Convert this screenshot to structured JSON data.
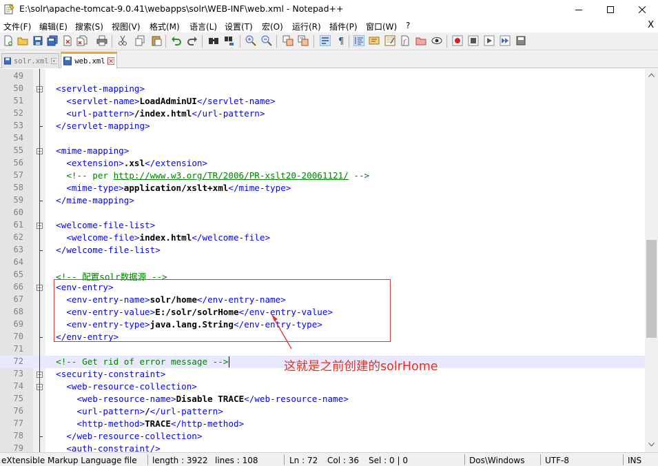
{
  "window": {
    "title": "E:\\solr\\apache-tomcat-9.0.41\\webapps\\solr\\WEB-INF\\web.xml - Notepad++"
  },
  "menu": {
    "items": [
      "文件(F)",
      "编辑(E)",
      "搜索(S)",
      "视图(V)",
      "格式(M)",
      "语言(L)",
      "设置(T)",
      "宏(O)",
      "运行(R)",
      "插件(P)",
      "窗口(W)",
      "?"
    ],
    "close": "X"
  },
  "tabs": [
    {
      "label": "solr.xml",
      "active": false
    },
    {
      "label": "web.xml",
      "active": true
    }
  ],
  "editor": {
    "current_line": 72,
    "lines": [
      {
        "n": "49",
        "segs": []
      },
      {
        "n": "50",
        "segs": [
          [
            "t",
            "  <servlet-mapping>"
          ]
        ]
      },
      {
        "n": "51",
        "segs": [
          [
            "t",
            "    <servlet-name>"
          ],
          [
            "x",
            "LoadAdminUI"
          ],
          [
            "t",
            "</servlet-name>"
          ]
        ]
      },
      {
        "n": "52",
        "segs": [
          [
            "t",
            "    <url-pattern>"
          ],
          [
            "x",
            "/index.html"
          ],
          [
            "t",
            "</url-pattern>"
          ]
        ]
      },
      {
        "n": "53",
        "segs": [
          [
            "t",
            "  </servlet-mapping>"
          ]
        ]
      },
      {
        "n": "54",
        "segs": []
      },
      {
        "n": "55",
        "segs": [
          [
            "t",
            "  <mime-mapping>"
          ]
        ]
      },
      {
        "n": "56",
        "segs": [
          [
            "t",
            "    <extension>"
          ],
          [
            "x",
            ".xsl"
          ],
          [
            "t",
            "</extension>"
          ]
        ]
      },
      {
        "n": "57",
        "segs": [
          [
            "c",
            "    <!-- per "
          ],
          [
            "u",
            "http://www.w3.org/TR/2006/PR-xslt20-20061121/"
          ],
          [
            "c",
            " -->"
          ]
        ]
      },
      {
        "n": "58",
        "segs": [
          [
            "t",
            "    <mime-type>"
          ],
          [
            "x",
            "application/xslt+xml"
          ],
          [
            "t",
            "</mime-type>"
          ]
        ]
      },
      {
        "n": "59",
        "segs": [
          [
            "t",
            "  </mime-mapping>"
          ]
        ]
      },
      {
        "n": "60",
        "segs": []
      },
      {
        "n": "61",
        "segs": [
          [
            "t",
            "  <welcome-file-list>"
          ]
        ]
      },
      {
        "n": "62",
        "segs": [
          [
            "t",
            "    <welcome-file>"
          ],
          [
            "x",
            "index.html"
          ],
          [
            "t",
            "</welcome-file>"
          ]
        ]
      },
      {
        "n": "63",
        "segs": [
          [
            "t",
            "  </welcome-file-list>"
          ]
        ]
      },
      {
        "n": "64",
        "segs": []
      },
      {
        "n": "65",
        "segs": [
          [
            "c",
            "  <!-- 配置solr数据源 -->"
          ]
        ]
      },
      {
        "n": "66",
        "segs": [
          [
            "t",
            "  <env-entry>"
          ]
        ]
      },
      {
        "n": "67",
        "segs": [
          [
            "t",
            "    <env-entry-name>"
          ],
          [
            "x",
            "solr/home"
          ],
          [
            "t",
            "</env-entry-name>"
          ]
        ]
      },
      {
        "n": "68",
        "segs": [
          [
            "t",
            "    <env-entry-value>"
          ],
          [
            "x",
            "E:/solr/solrHome"
          ],
          [
            "t",
            "</env-entry-value>"
          ]
        ]
      },
      {
        "n": "69",
        "segs": [
          [
            "t",
            "    <env-entry-type>"
          ],
          [
            "x",
            "java.lang.String"
          ],
          [
            "t",
            "</env-entry-type>"
          ]
        ]
      },
      {
        "n": "70",
        "segs": [
          [
            "t",
            "  </env-entry>"
          ]
        ]
      },
      {
        "n": "71",
        "segs": []
      },
      {
        "n": "72",
        "segs": [
          [
            "c",
            "  <!-- Get rid of error message -->"
          ]
        ]
      },
      {
        "n": "73",
        "segs": [
          [
            "t",
            "  <security-constraint>"
          ]
        ]
      },
      {
        "n": "74",
        "segs": [
          [
            "t",
            "    <web-resource-collection>"
          ]
        ]
      },
      {
        "n": "75",
        "segs": [
          [
            "t",
            "      <web-resource-name>"
          ],
          [
            "x",
            "Disable TRACE"
          ],
          [
            "t",
            "</web-resource-name>"
          ]
        ]
      },
      {
        "n": "76",
        "segs": [
          [
            "t",
            "      <url-pattern>"
          ],
          [
            "x",
            "/"
          ],
          [
            "t",
            "</url-pattern>"
          ]
        ]
      },
      {
        "n": "77",
        "segs": [
          [
            "t",
            "      <http-method>"
          ],
          [
            "x",
            "TRACE"
          ],
          [
            "t",
            "</http-method>"
          ]
        ]
      },
      {
        "n": "78",
        "segs": [
          [
            "t",
            "    </web-resource-collection>"
          ]
        ]
      },
      {
        "n": "79",
        "segs": [
          [
            "t",
            "    <auth-constraint/>"
          ]
        ]
      }
    ]
  },
  "annotation": {
    "text": "这就是之前创建的solrHome",
    "color": "#e8311a"
  },
  "status": {
    "file_type": "eXtensible Markup Language file",
    "length": "length : 3922",
    "lines": "lines : 108",
    "ln": "Ln : 72",
    "col": "Col : 36",
    "sel": "Sel : 0 | 0",
    "eol": "Dos\\Windows",
    "encoding": "UTF-8",
    "mode": "INS"
  },
  "colors": {
    "tag": "#0000ff",
    "comment": "#008000",
    "text": "#000000",
    "fold_line": "#d00000",
    "current_line": "#e8e8ff"
  },
  "toolbar_icons": [
    "new-file-icon",
    "open-file-icon",
    "save-icon",
    "save-all-icon",
    "close-icon",
    "close-all-icon",
    "print-icon",
    "cut-icon",
    "copy-icon",
    "paste-icon",
    "undo-icon",
    "redo-icon",
    "find-icon",
    "replace-icon",
    "zoom-in-icon",
    "zoom-out-icon",
    "sync-vertical-icon",
    "sync-horizontal-icon",
    "word-wrap-icon",
    "show-all-chars-icon",
    "indent-guide-icon",
    "language-icon",
    "doc-map-icon",
    "function-list-icon",
    "folder-workspace-icon",
    "monitor-icon",
    "record-macro-icon",
    "stop-macro-icon",
    "play-macro-icon",
    "run-macro-multiple-icon",
    "save-macro-icon"
  ]
}
